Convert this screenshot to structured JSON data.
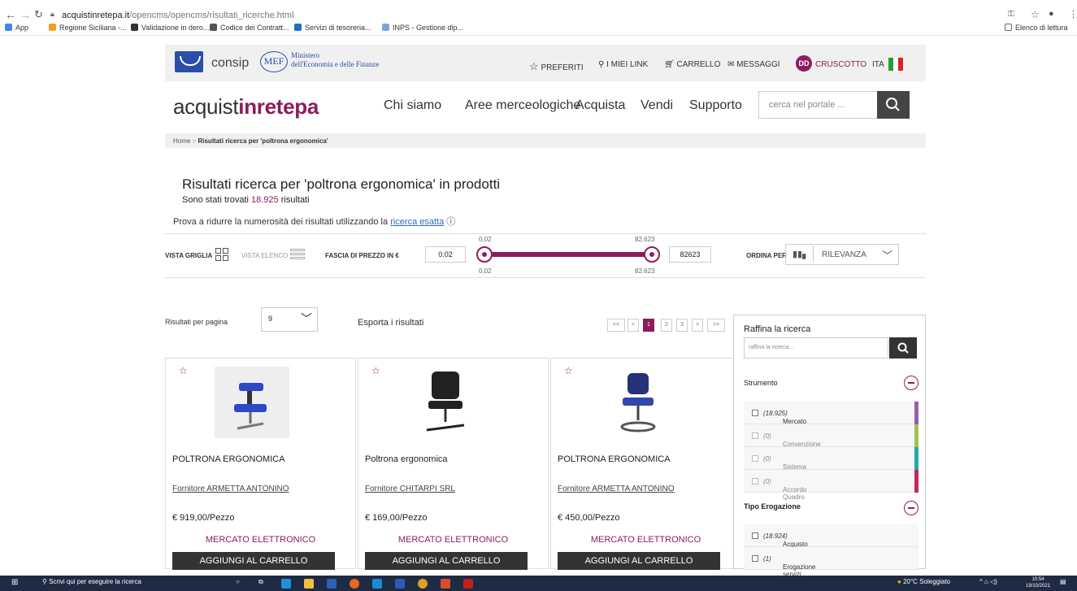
{
  "browser": {
    "url_domain": "acquistinretepa.it",
    "url_path": "/opencms/opencms/risultati_ricerche.html",
    "reading_list": "Elenco di lettura"
  },
  "bookmarks": [
    "App",
    "Regione Siciliana -...",
    "Validazione in dero...",
    "Codice dei Contratt...",
    "Servizi di tesoreria...",
    "INPS - Gestione dip..."
  ],
  "topbar": {
    "consip": "consip",
    "mef": "MEF",
    "ministero_1": "Ministero",
    "ministero_2": "dell'Economia e delle Finanze",
    "preferiti": "PREFERITI",
    "miei_link": "I MIEI LINK",
    "carrello": "CARRELLO",
    "messaggi": "MESSAGGI",
    "avatar": "DD",
    "cruscotto": "CRUSCOTTO",
    "lang": "ITA"
  },
  "brand": {
    "part1": "acquist",
    "part2": "inrete",
    "part3": "pa"
  },
  "nav": [
    "Chi siamo",
    "Aree merceologiche",
    "Acquista",
    "Vendi",
    "Supporto"
  ],
  "search": {
    "placeholder": "cerca nel portale ..."
  },
  "breadcrumb": {
    "home": "Home",
    "sep": ">",
    "current": "Risultati ricerca per 'poltrona ergonomica'"
  },
  "results": {
    "title": "Risultati ricerca per 'poltrona ergonomica' in prodotti",
    "found_pre": "Sono stati trovati",
    "found_num": "18.925",
    "found_post": "risultati",
    "hint": "Prova a ridurre la numerosità dei risultati utilizzando la",
    "hint_link": "ricerca esatta"
  },
  "filters": {
    "vista_griglia": "VISTA GRIGLIA",
    "vista_elenco": "VISTA ELENCO",
    "fascia": "FASCIA DI PREZZO IN €",
    "min": "0.02",
    "max": "82623",
    "min_top": "0,02",
    "max_top": "82.623",
    "min_bottom": "0,02",
    "max_bottom": "82.623",
    "ordina": "ORDINA PER",
    "sort": "RILEVANZA"
  },
  "list": {
    "per_page_label": "Risultati per pagina",
    "per_page": "9",
    "export": "Esporta i risultati",
    "pages": [
      "<<",
      "<",
      "1",
      "2",
      "3",
      ">",
      ">>"
    ]
  },
  "products": [
    {
      "name": "POLTRONA ERGONOMICA",
      "supplier": "Fornitore ARMETTA ANTONINO",
      "price": "€ 919,00/Pezzo",
      "channel": "MERCATO ELETTRONICO",
      "cart": "AGGIUNGI AL CARRELLO"
    },
    {
      "name": "Poltrona ergonomica",
      "supplier": "Fornitore CHITARPI SRL",
      "price": "€ 169,00/Pezzo",
      "channel": "MERCATO ELETTRONICO",
      "cart": "AGGIUNGI AL CARRELLO"
    },
    {
      "name": "POLTRONA ERGONOMICA",
      "supplier": "Fornitore ARMETTA ANTONINO",
      "price": "€ 450,00/Pezzo",
      "channel": "MERCATO ELETTRONICO",
      "cart": "AGGIUNGI AL CARRELLO"
    }
  ],
  "refine": {
    "title": "Raffina la ricerca",
    "placeholder": "raffina la ricerca...",
    "strumento": "Strumento",
    "strumento_opts": [
      {
        "label": "Mercato Elettronico",
        "count": "(18.925)",
        "color": "#9a5fa8"
      },
      {
        "label": "Convenzione",
        "count": "(0)",
        "color": "#a8c052"
      },
      {
        "label": "Sistema Dinamico",
        "count": "(0)",
        "color": "#2aa8a8"
      },
      {
        "label": "Accordo Quadro",
        "count": "(0)",
        "color": "#c02a5f"
      }
    ],
    "tipo": "Tipo Erogazione",
    "tipo_opts": [
      {
        "label": "Acquisto beni",
        "count": "(18.924)"
      },
      {
        "label": "Erogazione servizi",
        "count": "(1)"
      }
    ]
  },
  "taskbar": {
    "search": "Scrivi qui per eseguire la ricerca",
    "weather": "20°C Soleggiato",
    "time": "10:54",
    "date": "19/10/2021"
  },
  "colors": {
    "brand": "#8c1d5f",
    "dark": "#333333"
  }
}
